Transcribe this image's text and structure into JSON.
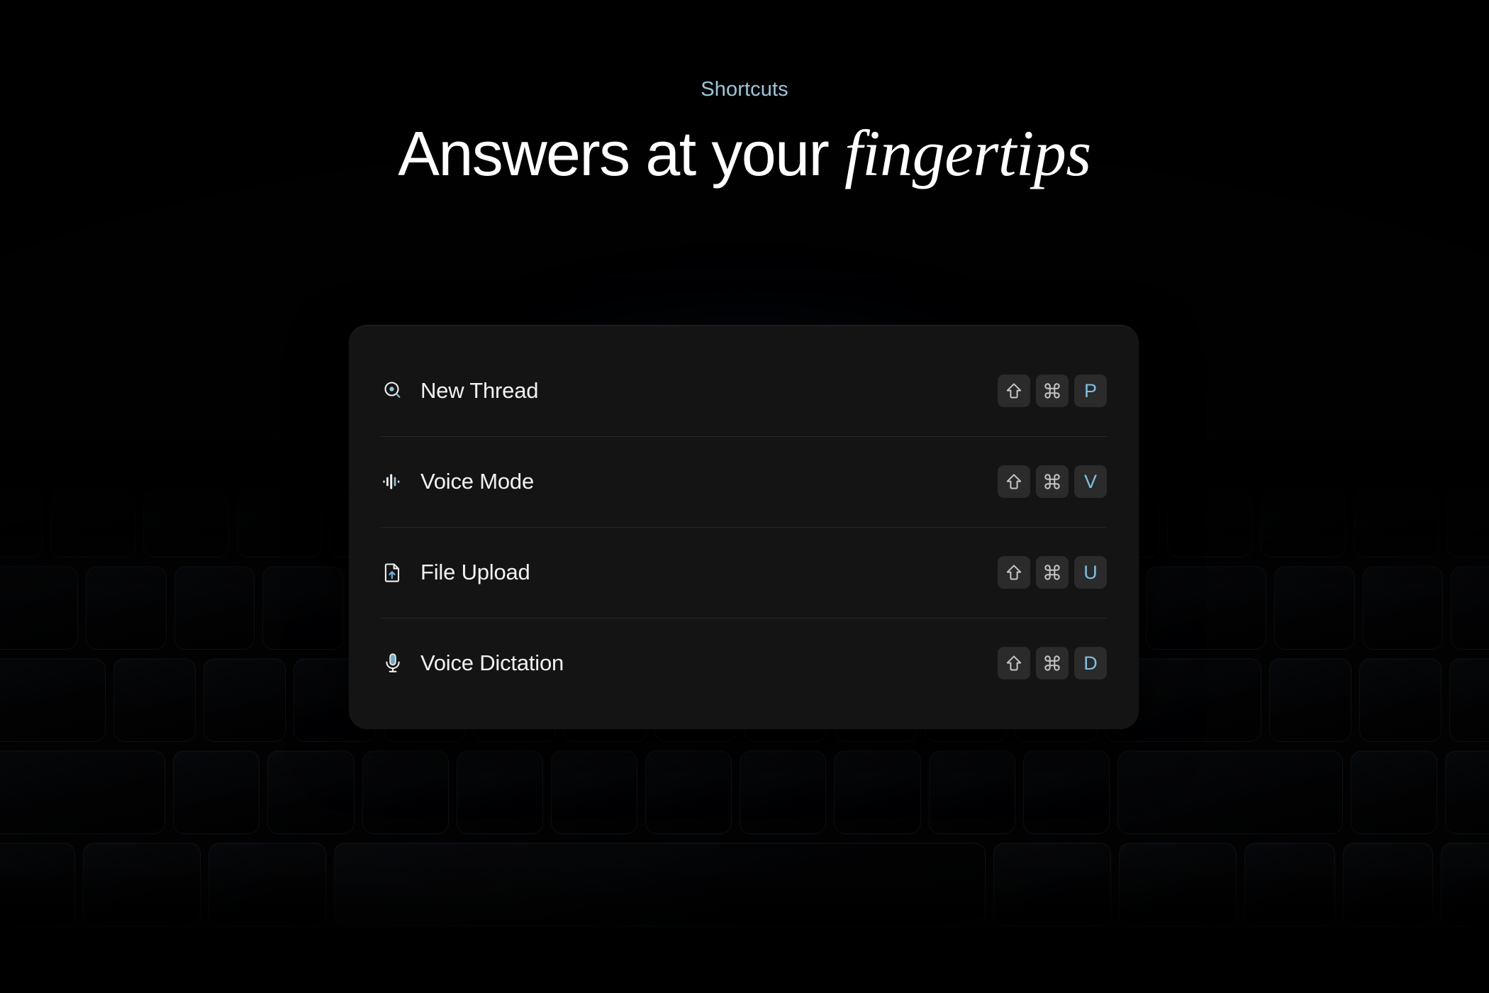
{
  "header": {
    "eyebrow": "Shortcuts",
    "headline_plain": "Answers at your ",
    "headline_emphasis": "fingertips"
  },
  "colors": {
    "page_background": "#000000",
    "card_background": "#141414",
    "eyebrow_accent": "#9cc6d8",
    "key_accent": "#7cc0e8",
    "key_background": "#2b2b2b",
    "label_text": "#f2f2f2",
    "divider": "rgba(255,255,255,0.085)"
  },
  "shortcuts": [
    {
      "label": "New Thread",
      "icon": "search-circle-icon",
      "keys": [
        {
          "glyph": "⇧",
          "name": "shift-key",
          "accent": false
        },
        {
          "glyph": "⌘",
          "name": "command-key",
          "accent": false
        },
        {
          "glyph": "P",
          "name": "letter-p-key",
          "accent": true
        }
      ]
    },
    {
      "label": "Voice Mode",
      "icon": "audio-waveform-icon",
      "keys": [
        {
          "glyph": "⇧",
          "name": "shift-key",
          "accent": false
        },
        {
          "glyph": "⌘",
          "name": "command-key",
          "accent": false
        },
        {
          "glyph": "V",
          "name": "letter-v-key",
          "accent": true
        }
      ]
    },
    {
      "label": "File Upload",
      "icon": "file-upload-icon",
      "keys": [
        {
          "glyph": "⇧",
          "name": "shift-key",
          "accent": false
        },
        {
          "glyph": "⌘",
          "name": "command-key",
          "accent": false
        },
        {
          "glyph": "U",
          "name": "letter-u-key",
          "accent": true
        }
      ]
    },
    {
      "label": "Voice Dictation",
      "icon": "microphone-icon",
      "keys": [
        {
          "glyph": "⇧",
          "name": "shift-key",
          "accent": false
        },
        {
          "glyph": "⌘",
          "name": "command-key",
          "accent": false
        },
        {
          "glyph": "D",
          "name": "letter-d-key",
          "accent": true
        }
      ]
    }
  ]
}
